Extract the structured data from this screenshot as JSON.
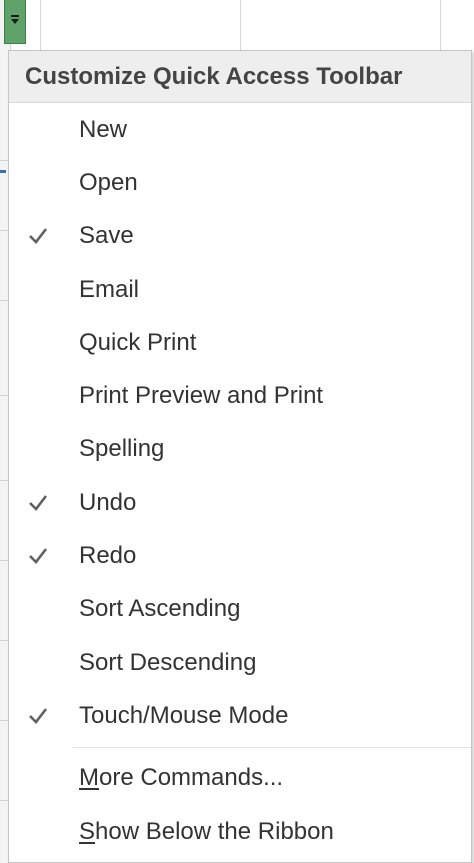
{
  "menu": {
    "title": "Customize Quick Access Toolbar",
    "items": [
      {
        "label": "New",
        "checked": false
      },
      {
        "label": "Open",
        "checked": false
      },
      {
        "label": "Save",
        "checked": true
      },
      {
        "label": "Email",
        "checked": false
      },
      {
        "label": "Quick Print",
        "checked": false
      },
      {
        "label": "Print Preview and Print",
        "checked": false
      },
      {
        "label": "Spelling",
        "checked": false
      },
      {
        "label": "Undo",
        "checked": true
      },
      {
        "label": "Redo",
        "checked": true
      },
      {
        "label": "Sort Ascending",
        "checked": false
      },
      {
        "label": "Sort Descending",
        "checked": false
      },
      {
        "label": "Touch/Mouse Mode",
        "checked": true
      }
    ],
    "more_commands": {
      "accesskey": "M",
      "rest": "ore Commands..."
    },
    "show_below": {
      "accesskey": "S",
      "rest": "how Below the Ribbon"
    }
  },
  "colors": {
    "qat_button": "#5fa36b",
    "check": "#606060"
  }
}
